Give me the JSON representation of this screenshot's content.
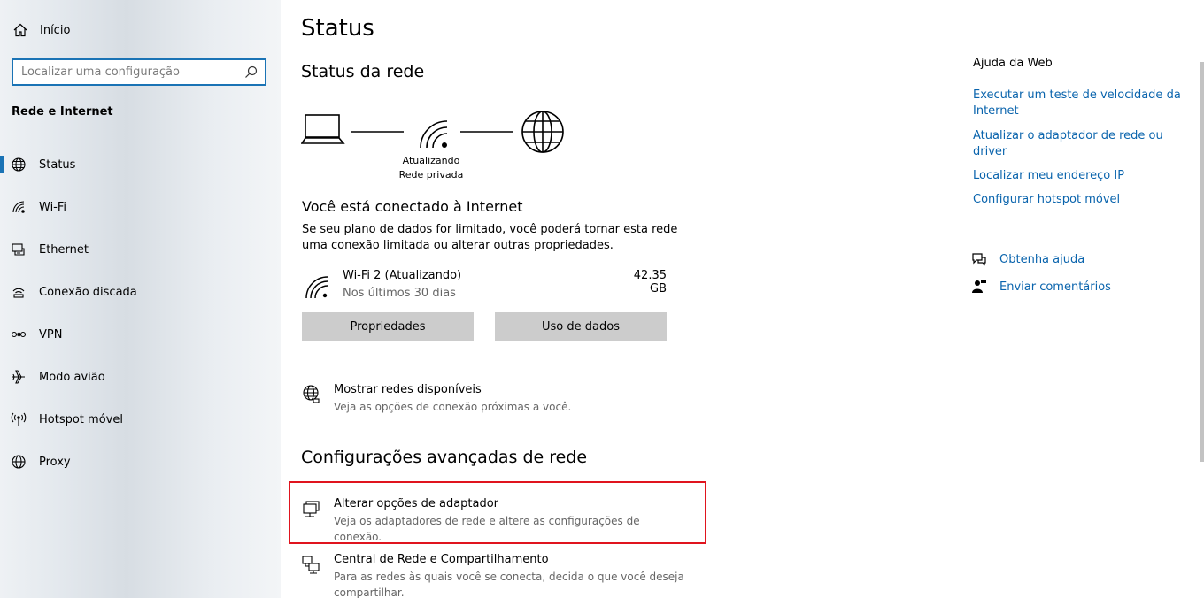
{
  "sidebar": {
    "home_label": "Início",
    "search_placeholder": "Localizar uma configuração",
    "section_title": "Rede e Internet",
    "items": [
      {
        "label": "Status"
      },
      {
        "label": "Wi-Fi"
      },
      {
        "label": "Ethernet"
      },
      {
        "label": "Conexão discada"
      },
      {
        "label": "VPN"
      },
      {
        "label": "Modo avião"
      },
      {
        "label": "Hotspot móvel"
      },
      {
        "label": "Proxy"
      }
    ]
  },
  "main": {
    "title": "Status",
    "network_status_heading": "Status da rede",
    "diagram_caption_line1": "Atualizando",
    "diagram_caption_line2": "Rede privada",
    "connected_heading": "Você está conectado à Internet",
    "connected_desc": "Se seu plano de dados for limitado, você poderá tornar esta rede uma conexão limitada ou alterar outras propriedades.",
    "connection": {
      "name": "Wi-Fi 2 (Atualizando)",
      "sub": "Nos últimos 30 dias",
      "usage": "42.35 GB"
    },
    "buttons": {
      "properties": "Propriedades",
      "data_usage": "Uso de dados"
    },
    "show_networks": {
      "title": "Mostrar redes disponíveis",
      "sub": "Veja as opções de conexão próximas a você."
    },
    "advanced_heading": "Configurações avançadas de rede",
    "adapter_options": {
      "title": "Alterar opções de adaptador",
      "sub": "Veja os adaptadores de rede e altere as configurações de conexão."
    },
    "sharing_center": {
      "title": "Central de Rede e Compartilhamento",
      "sub": "Para as redes às quais você se conecta, decida o que você deseja compartilhar."
    }
  },
  "right": {
    "web_help_title": "Ajuda da Web",
    "links": [
      "Executar um teste de velocidade da Internet",
      "Atualizar o adaptador de rede ou driver",
      "Localizar meu endereço IP",
      "Configurar hotspot móvel"
    ],
    "get_help": "Obtenha ajuda",
    "feedback": "Enviar comentários"
  },
  "colors": {
    "accent": "#1a73b5",
    "link": "#0a64ad",
    "highlight": "#e0141e",
    "button": "#cccccc"
  }
}
